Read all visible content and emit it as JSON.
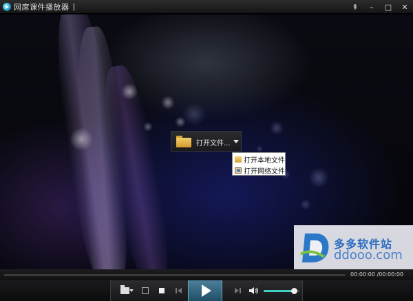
{
  "window": {
    "title": "网席课件播放器",
    "caret": "|",
    "buttons": {
      "pin": "⇞",
      "minimize": "–",
      "maximize": "□",
      "close": "✕"
    }
  },
  "open_button": {
    "label": "打开文件..."
  },
  "menu": {
    "items": [
      {
        "label": "打开本地文件",
        "icon": "folder-icon"
      },
      {
        "label": "打开网络文件",
        "icon": "network-icon"
      }
    ]
  },
  "watermark": {
    "text": "多多软件站",
    "url": "ddooo.com"
  },
  "playback": {
    "time": "00:00:00 /00:00:00",
    "progress": 0,
    "volume": 0.85
  },
  "colors": {
    "accent": "#3fd0c0",
    "play_button": "#2f6a86"
  }
}
